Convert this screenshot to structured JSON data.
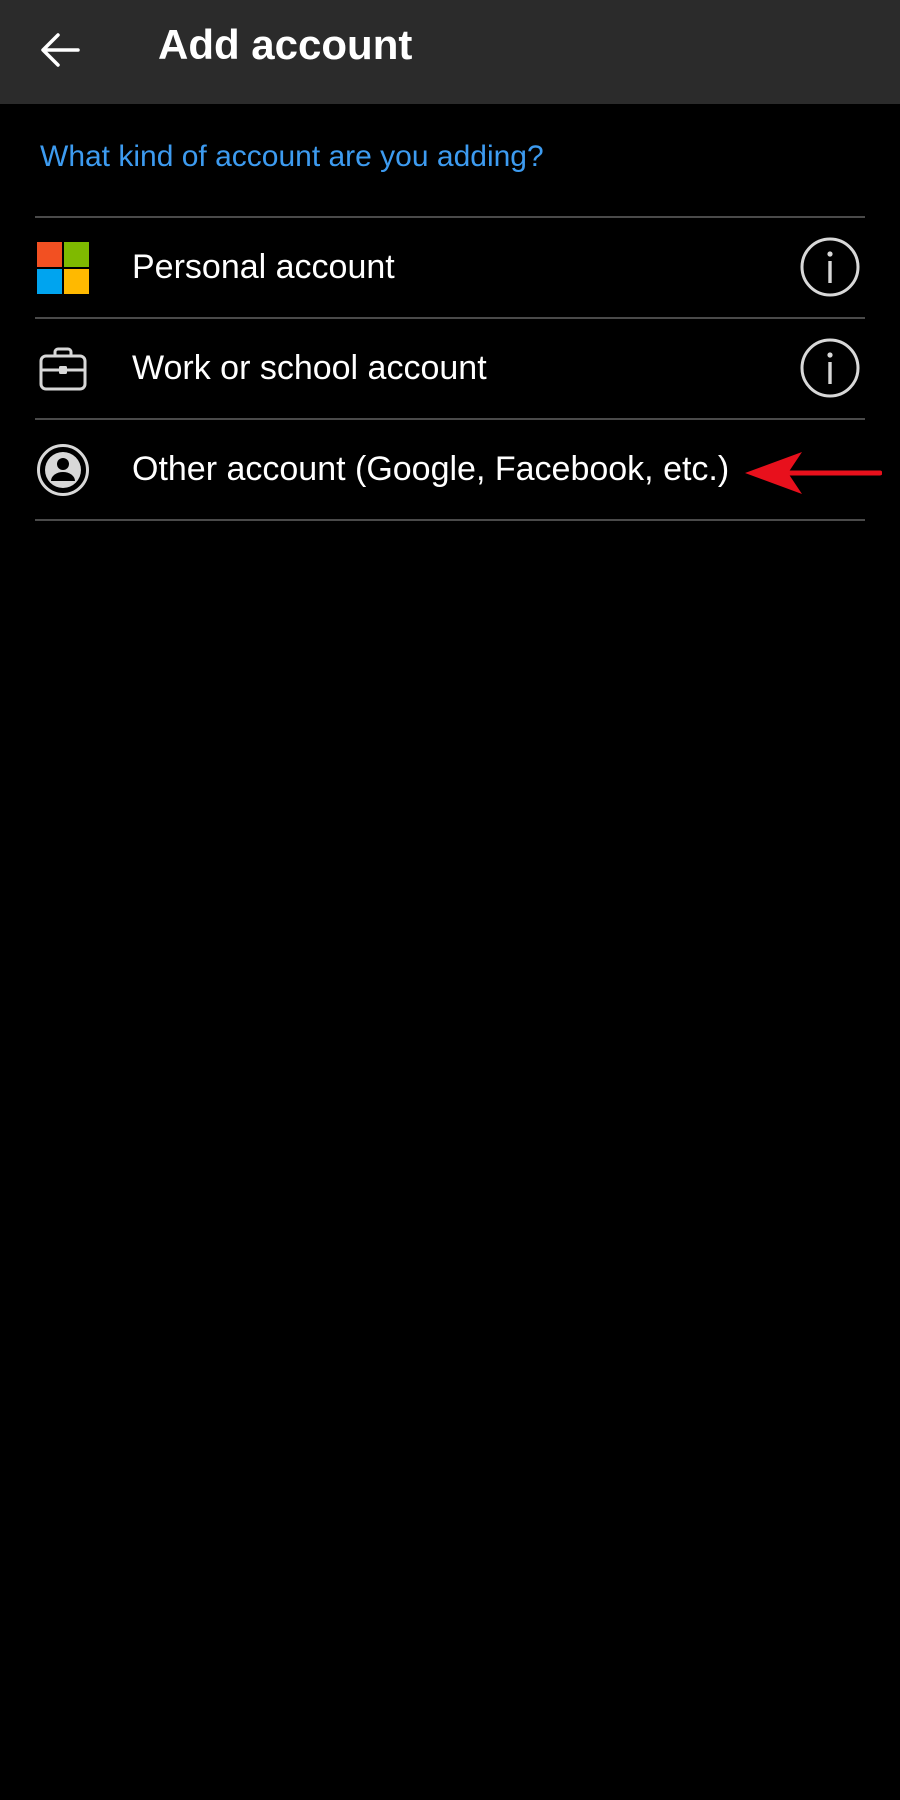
{
  "appbar": {
    "title": "Add account",
    "back_icon": "arrow-left-icon"
  },
  "prompt": "What kind of account are you adding?",
  "accounts": [
    {
      "label": "Personal account",
      "icon": "microsoft-logo-icon",
      "info_icon": "info-circle-icon"
    },
    {
      "label": "Work or school account",
      "icon": "briefcase-icon",
      "info_icon": "info-circle-icon"
    },
    {
      "label": "Other account (Google, Facebook, etc.)",
      "icon": "person-circle-icon"
    }
  ],
  "colors": {
    "background": "#000000",
    "appbar": "#2b2b2b",
    "accent": "#3d9bf0",
    "divider": "#4a4a4a",
    "annotation_arrow": "#e8101c",
    "ms_red": "#f25022",
    "ms_green": "#7fba00",
    "ms_blue": "#00a4ef",
    "ms_yellow": "#ffb900"
  }
}
